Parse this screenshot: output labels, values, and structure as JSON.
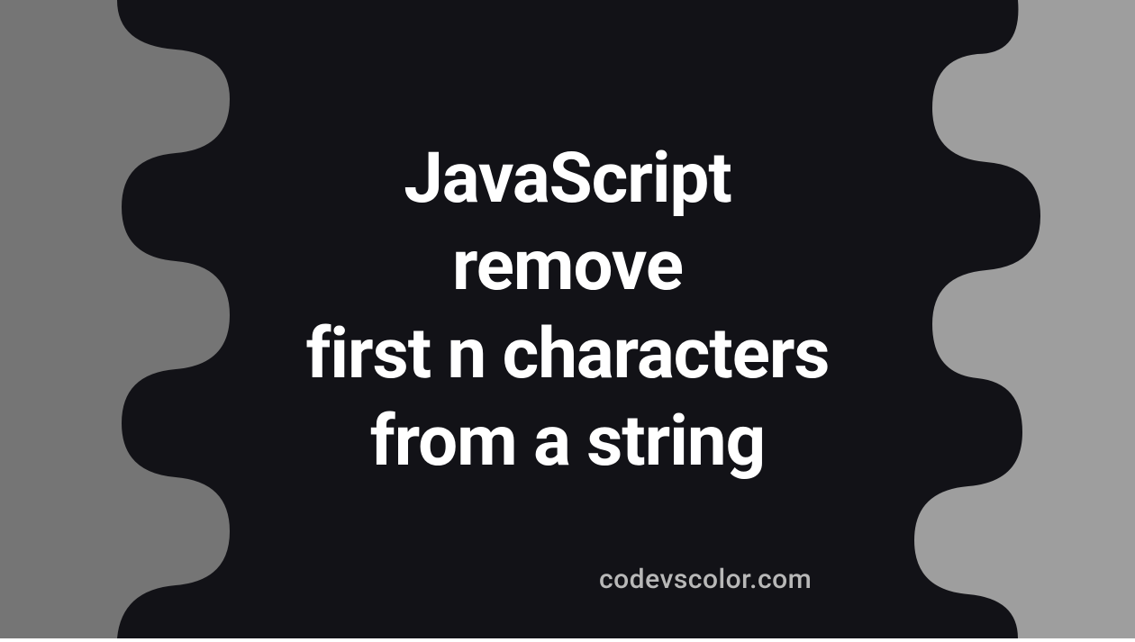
{
  "title_lines": {
    "line1": "JavaScript",
    "line2": "remove",
    "line3": "first n characters",
    "line4": "from a string"
  },
  "watermark": "codevscolor.com",
  "colors": {
    "bg_left": "#757575",
    "bg_right": "#9e9e9e",
    "blob": "#121217",
    "text": "#ffffff",
    "watermark": "#b8b8b8"
  }
}
